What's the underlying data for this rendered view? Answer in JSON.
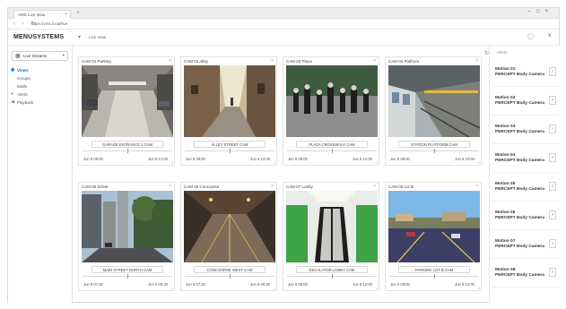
{
  "browser": {
    "tab_title": "VMS Live View",
    "tab_close": "×",
    "new_tab": "+",
    "window_controls": "–□×",
    "nav_arrows": "‹ › ↻",
    "url": "https://vms.local/live"
  },
  "header": {
    "brand": "MENUSYSTEMS",
    "brand_caret": "▾",
    "search_label": "Live View",
    "user_icon": "user-icon",
    "close": "×"
  },
  "sidebar": {
    "selector_label": "Live Streams",
    "selector_icon": "grid-icon",
    "items": [
      {
        "label": "Views",
        "icon": "eye-icon",
        "active": true
      },
      {
        "label": "Groups",
        "icon": "",
        "active": false
      },
      {
        "label": "Walls",
        "icon": "",
        "active": false
      },
      {
        "label": "Alerts",
        "icon": "bell-icon",
        "active": false
      },
      {
        "label": "Playback",
        "icon": "play-icon",
        "active": false
      }
    ]
  },
  "cameras": [
    {
      "title": "CAM 01 Parking",
      "scene": "garage",
      "name": "GARAGE ENTRANCE 1 CAM",
      "start": "Jun 9 08:00",
      "end": "Jun 9 12:00"
    },
    {
      "title": "CAM 02 Alley",
      "scene": "alley",
      "name": "ALLEY STREET CAM",
      "start": "Jun 9 08:00",
      "end": "Jun 9 12:00"
    },
    {
      "title": "CAM 03 Plaza",
      "scene": "crowd",
      "name": "PLAZA CROSSWALK CAM",
      "start": "Jun 9 08:00",
      "end": "Jun 9 12:00"
    },
    {
      "title": "CAM 04 Platform",
      "scene": "station",
      "name": "STATION PLATFORM CAM",
      "start": "Jun 9 08:00",
      "end": "Jun 9 12:00"
    },
    {
      "title": "CAM 05 Street",
      "scene": "city",
      "name": "MAIN STREET NORTH CAM",
      "start": "Jun 9 07:30",
      "end": "Jun 9 09:30"
    },
    {
      "title": "CAM 06 Concourse",
      "scene": "hall",
      "name": "CONCOURSE WEST CAM",
      "start": "Jun 9 07:30",
      "end": "Jun 9 09:30"
    },
    {
      "title": "CAM 07 Lobby",
      "scene": "escalator",
      "name": "ESCALATOR LOBBY CAM",
      "start": "Jun 9 08:00",
      "end": "Jun 9 12:00"
    },
    {
      "title": "CAM 08 Lot B",
      "scene": "lot",
      "name": "PARKING LOT B CAM",
      "start": "Jun 9 08:00",
      "end": "Jun 9 12:00"
    }
  ],
  "alerts": {
    "header": "Alerts",
    "items": [
      {
        "title": "Motion 01",
        "subtitle": "PERCEPT Body Camera"
      },
      {
        "title": "Motion 02",
        "subtitle": "PERCEPT Body Camera"
      },
      {
        "title": "Motion 03",
        "subtitle": "PERCEPT Body Camera"
      },
      {
        "title": "Motion 04",
        "subtitle": "PERCEPT Body Camera"
      },
      {
        "title": "Motion 05",
        "subtitle": "PERCEPT Body Camera"
      },
      {
        "title": "Motion 06",
        "subtitle": "PERCEPT Body Camera"
      },
      {
        "title": "Motion 07",
        "subtitle": "PERCEPT Body Camera"
      },
      {
        "title": "Motion 08",
        "subtitle": "PERCEPT Body Camera"
      }
    ]
  }
}
